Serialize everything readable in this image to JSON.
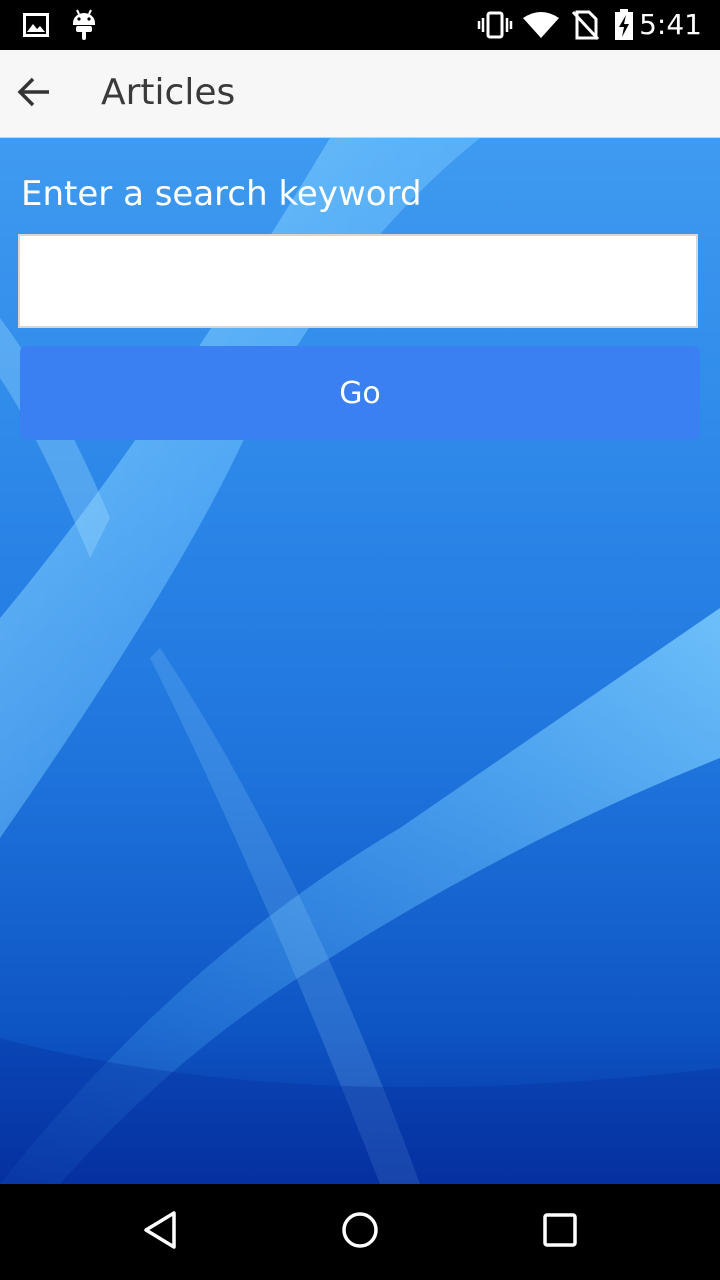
{
  "status_bar": {
    "time": "5:41",
    "icons": [
      "image-icon",
      "android-icon",
      "vibrate-icon",
      "wifi-icon",
      "no-sim-icon",
      "battery-charging-icon"
    ]
  },
  "app_bar": {
    "title": "Articles",
    "back_icon": "arrow-back-icon"
  },
  "search": {
    "prompt": "Enter a search keyword",
    "value": "",
    "placeholder": "",
    "button_label": "Go"
  },
  "nav_bar": {
    "icons": [
      "back-triangle-icon",
      "home-circle-icon",
      "recents-square-icon"
    ]
  },
  "colors": {
    "button": "#3b80f3",
    "app_bar": "#f7f7f7",
    "background_top": "#3f9af0",
    "background_bottom": "#0630a0"
  }
}
